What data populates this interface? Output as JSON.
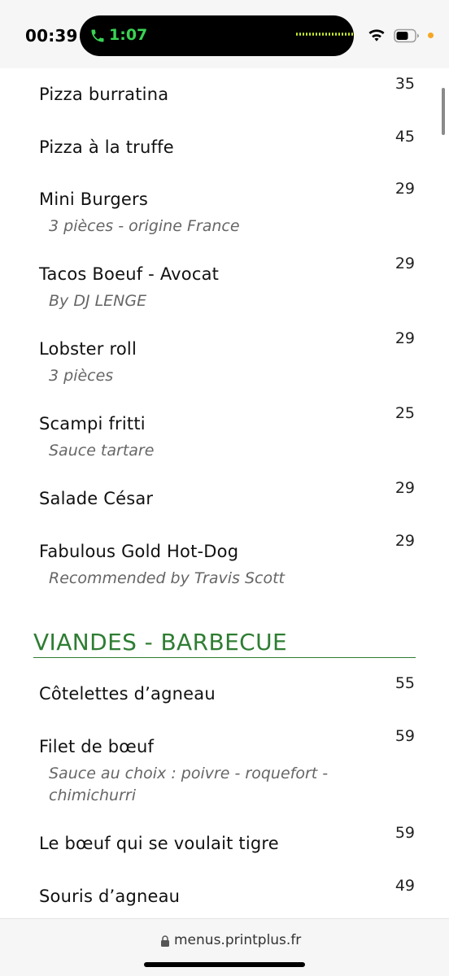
{
  "status_bar": {
    "time": "00:39",
    "call_time": "1:07",
    "call_icon": "phone-icon",
    "wifi_icon": "wifi-icon",
    "battery_icon": "battery-icon",
    "accent_call": "#39d353",
    "privacy_dot": "#f5a623"
  },
  "menu": {
    "items": [
      {
        "name": "Pizza burratina",
        "price": "35",
        "desc": ""
      },
      {
        "name": "Pizza à la truffe",
        "price": "45",
        "desc": ""
      },
      {
        "name": "Mini Burgers",
        "price": "29",
        "desc": "3 pièces - origine France"
      },
      {
        "name": "Tacos Boeuf - Avocat",
        "price": "29",
        "desc": "By DJ LENGE"
      },
      {
        "name": "Lobster roll",
        "price": "29",
        "desc": "3 pièces"
      },
      {
        "name": "Scampi fritti",
        "price": "25",
        "desc": "Sauce tartare"
      },
      {
        "name": "Salade César",
        "price": "29",
        "desc": ""
      },
      {
        "name": "Fabulous Gold Hot-Dog",
        "price": "29",
        "desc": "Recommended by Travis Scott"
      }
    ],
    "section": {
      "title": "VIANDES - BARBECUE",
      "color": "#2e7d32",
      "items": [
        {
          "name": "Côtelettes d’agneau",
          "price": "55",
          "desc": ""
        },
        {
          "name": "Filet de bœuf",
          "price": "59",
          "desc": "Sauce au choix : poivre - roquefort - chimichurri"
        },
        {
          "name": "Le bœuf qui se voulait tigre",
          "price": "59",
          "desc": ""
        },
        {
          "name": "Souris d’agneau",
          "price": "49",
          "desc": ""
        }
      ]
    }
  },
  "browser": {
    "url": "menus.printplus.fr",
    "lock_icon": "lock-icon"
  }
}
